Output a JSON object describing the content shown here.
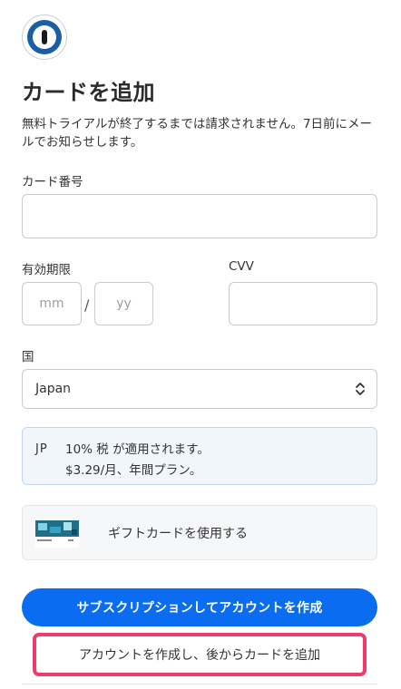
{
  "app": {
    "logo_icon": "1password-key-icon"
  },
  "page": {
    "title": "カードを追加",
    "subtitle": "無料トライアルが終了するまでは請求されません。7日前にメールでお知らせします。"
  },
  "card_number": {
    "label": "カード番号",
    "value": "",
    "placeholder": ""
  },
  "expiry": {
    "label": "有効期限",
    "month_placeholder": "mm",
    "year_placeholder": "yy",
    "separator": "/"
  },
  "cvv": {
    "label": "CVV",
    "value": ""
  },
  "country": {
    "label": "国",
    "selected": "Japan",
    "icon": "chevron-up-down-icon"
  },
  "tax_notice": {
    "code": "JP",
    "line1": "10% 税 が適用されます。",
    "line2": "$3.29/月、年間プラン。",
    "bg_color": "#f1f6fc"
  },
  "gift_card": {
    "label": "ギフトカードを使用する",
    "icon": "gift-card-icon"
  },
  "actions": {
    "primary_label": "サブスクリプションしてアカウントを作成",
    "secondary_label": "アカウントを作成し、後からカードを追加"
  },
  "colors": {
    "accent": "#0a6cf0",
    "highlight": "#ec3c6d"
  }
}
